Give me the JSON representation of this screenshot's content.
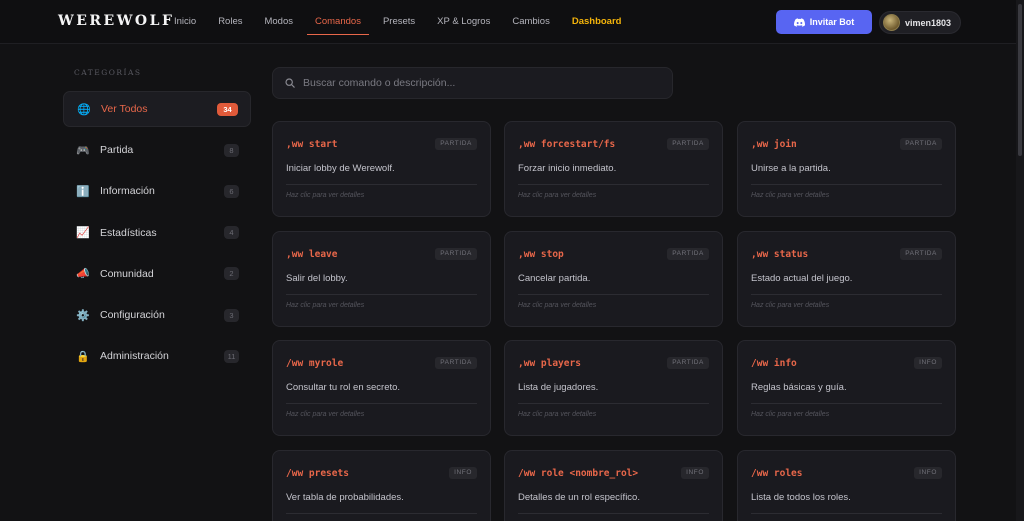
{
  "header": {
    "logo": "WEREWOLF",
    "nav": [
      {
        "label": "Inicio",
        "state": "normal"
      },
      {
        "label": "Roles",
        "state": "normal"
      },
      {
        "label": "Modos",
        "state": "normal"
      },
      {
        "label": "Comandos",
        "state": "active"
      },
      {
        "label": "Presets",
        "state": "normal"
      },
      {
        "label": "XP & Logros",
        "state": "normal"
      },
      {
        "label": "Cambios",
        "state": "normal"
      },
      {
        "label": "Dashboard",
        "state": "highlight"
      }
    ],
    "invite_label": "Invitar Bot",
    "username": "vimen1803"
  },
  "sidebar": {
    "title": "CATEGORÍAS",
    "items": [
      {
        "label": "Ver Todos",
        "count": "34",
        "icon": "globe-icon",
        "glyph": "🌐",
        "active": true
      },
      {
        "label": "Partida",
        "count": "8",
        "icon": "gamepad-icon",
        "glyph": "🎮",
        "active": false
      },
      {
        "label": "Información",
        "count": "6",
        "icon": "info-icon",
        "glyph": "ℹ️",
        "active": false
      },
      {
        "label": "Estadísticas",
        "count": "4",
        "icon": "chart-icon",
        "glyph": "📈",
        "active": false
      },
      {
        "label": "Comunidad",
        "count": "2",
        "icon": "megaphone-icon",
        "glyph": "📣",
        "active": false
      },
      {
        "label": "Configuración",
        "count": "3",
        "icon": "gear-icon",
        "glyph": "⚙️",
        "active": false
      },
      {
        "label": "Administración",
        "count": "11",
        "icon": "lock-icon",
        "glyph": "🔒",
        "active": false
      }
    ]
  },
  "search": {
    "placeholder": "Buscar comando o descripción...",
    "value": ""
  },
  "cards": [
    {
      "command": ",ww start",
      "badge": "PARTIDA",
      "description": "Iniciar lobby de Werewolf.",
      "hint": "Haz clic para ver detalles"
    },
    {
      "command": ",ww forcestart/fs",
      "badge": "PARTIDA",
      "description": "Forzar inicio inmediato.",
      "hint": "Haz clic para ver detalles"
    },
    {
      "command": ",ww join",
      "badge": "PARTIDA",
      "description": "Unirse a la partida.",
      "hint": "Haz clic para ver detalles"
    },
    {
      "command": ",ww leave",
      "badge": "PARTIDA",
      "description": "Salir del lobby.",
      "hint": "Haz clic para ver detalles"
    },
    {
      "command": ",ww stop",
      "badge": "PARTIDA",
      "description": "Cancelar partida.",
      "hint": "Haz clic para ver detalles"
    },
    {
      "command": ",ww status",
      "badge": "PARTIDA",
      "description": "Estado actual del juego.",
      "hint": "Haz clic para ver detalles"
    },
    {
      "command": "/ww myrole",
      "badge": "PARTIDA",
      "description": "Consultar tu rol en secreto.",
      "hint": "Haz clic para ver detalles"
    },
    {
      "command": ",ww players",
      "badge": "PARTIDA",
      "description": "Lista de jugadores.",
      "hint": "Haz clic para ver detalles"
    },
    {
      "command": "/ww info",
      "badge": "INFO",
      "description": "Reglas básicas y guía.",
      "hint": "Haz clic para ver detalles"
    },
    {
      "command": "/ww presets",
      "badge": "INFO",
      "description": "Ver tabla de probabilidades.",
      "hint": ""
    },
    {
      "command": "/ww role <nombre_rol>",
      "badge": "INFO",
      "description": "Detalles de un rol específico.",
      "hint": ""
    },
    {
      "command": "/ww roles",
      "badge": "INFO",
      "description": "Lista de todos los roles.",
      "hint": ""
    }
  ],
  "colors": {
    "accent": "#e8674a",
    "discord": "#5865f2",
    "dashboard": "#f4b40b"
  }
}
